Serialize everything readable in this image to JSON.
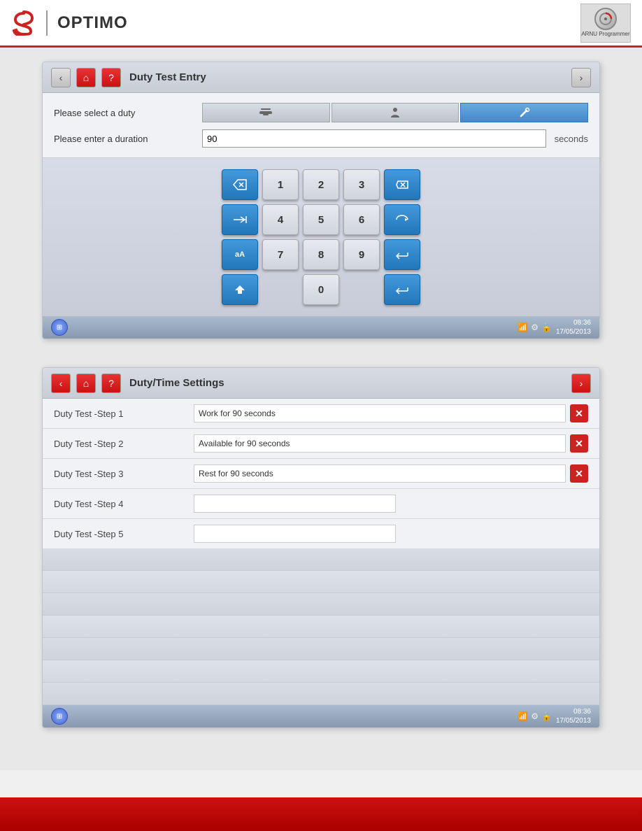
{
  "header": {
    "brand": "Stoneridge",
    "product": "OPTIMO",
    "icon_label": "ARNU Programmer"
  },
  "panel1": {
    "title": "Duty Test Entry",
    "nav_back": "‹",
    "nav_fwd": "›",
    "home_label": "⌂",
    "help_label": "?",
    "form": {
      "duty_label": "Please select a duty",
      "duration_label": "Please enter a duration",
      "duration_value": "90",
      "seconds_label": "seconds",
      "duty_options": [
        "drive",
        "available",
        "work"
      ],
      "active_duty": 2
    },
    "keypad": {
      "keys": [
        "1",
        "2",
        "3",
        "4",
        "5",
        "6",
        "7",
        "8",
        "9",
        "0"
      ]
    },
    "status_bar": {
      "time": "08:36",
      "date": "17/05/2013"
    }
  },
  "panel2": {
    "title": "Duty/Time Settings",
    "nav_back": "‹",
    "nav_fwd": "›",
    "home_label": "⌂",
    "help_label": "?",
    "steps": [
      {
        "label": "Duty Test -Step 1",
        "value": "Work for 90 seconds",
        "has_delete": true
      },
      {
        "label": "Duty Test -Step 2",
        "value": "Available for 90 seconds",
        "has_delete": true
      },
      {
        "label": "Duty Test -Step 3",
        "value": "Rest for 90 seconds",
        "has_delete": true
      },
      {
        "label": "Duty Test -Step 4",
        "value": "",
        "has_delete": false
      },
      {
        "label": "Duty Test -Step 5",
        "value": "",
        "has_delete": false
      }
    ],
    "status_bar": {
      "time": "08:36",
      "date": "17/05/2013"
    }
  },
  "colors": {
    "accent_red": "#cc2222",
    "nav_blue": "#4499dd",
    "active_blue": "#4488cc"
  }
}
